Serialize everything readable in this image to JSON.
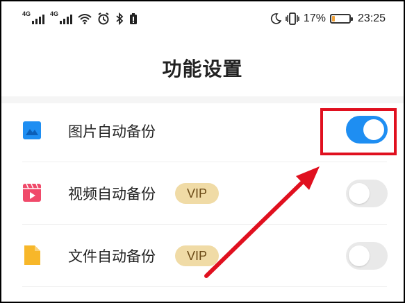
{
  "status_bar": {
    "network_1": "4G",
    "network_2": "4G",
    "battery_percent": "17%",
    "time": "23:25",
    "battery_level": 0.17,
    "icons": [
      "signal-icon",
      "signal-icon",
      "wifi-icon",
      "alarm-icon",
      "bluetooth-icon",
      "battery-alert-icon",
      "moon-icon",
      "vibrate-icon",
      "battery-icon"
    ]
  },
  "page": {
    "title": "功能设置"
  },
  "settings": [
    {
      "label": "图片自动备份",
      "vip": "",
      "enabled": true,
      "icon": "image-icon",
      "icon_color": "#1e8ef2"
    },
    {
      "label": "视频自动备份",
      "vip": "VIP",
      "enabled": false,
      "icon": "video-icon",
      "icon_color": "#f04a6a"
    },
    {
      "label": "文件自动备份",
      "vip": "VIP",
      "enabled": false,
      "icon": "file-icon",
      "icon_color": "#f7b72a"
    }
  ],
  "colors": {
    "accent": "#1e8ef2",
    "annotation": "#e0101f",
    "vip_bg": "#f0dba6"
  }
}
